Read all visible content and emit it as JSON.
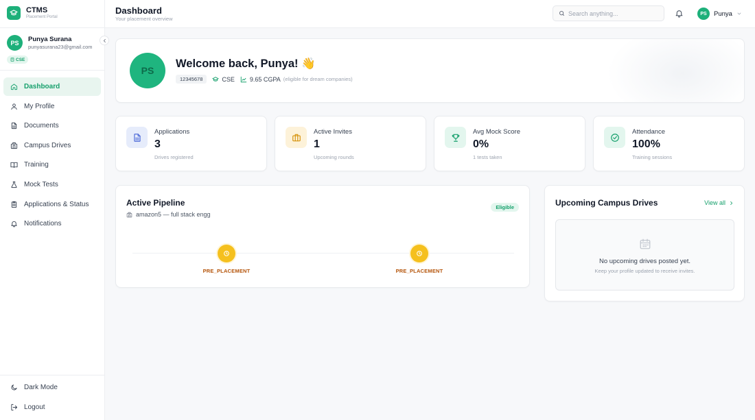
{
  "brand": {
    "name": "CTMS",
    "subtitle": "Placement Portal"
  },
  "user": {
    "initials": "PS",
    "name": "Punya Surana",
    "email": "punyasurana23@gmail.com",
    "department": "CSE",
    "first_name": "Punya"
  },
  "sidebar": {
    "items": [
      {
        "label": "Dashboard",
        "icon": "home-icon",
        "active": true
      },
      {
        "label": "My Profile",
        "icon": "user-icon"
      },
      {
        "label": "Documents",
        "icon": "document-icon"
      },
      {
        "label": "Campus Drives",
        "icon": "building-icon"
      },
      {
        "label": "Training",
        "icon": "book-icon"
      },
      {
        "label": "Mock Tests",
        "icon": "flask-icon"
      },
      {
        "label": "Applications & Status",
        "icon": "clipboard-icon"
      },
      {
        "label": "Notifications",
        "icon": "bell-icon"
      }
    ],
    "bottom": [
      {
        "label": "Dark Mode",
        "icon": "moon-icon"
      },
      {
        "label": "Logout",
        "icon": "logout-icon"
      }
    ]
  },
  "header": {
    "title": "Dashboard",
    "subtitle": "Your placement overview",
    "search_placeholder": "Search anything...",
    "user_name": "Punya"
  },
  "welcome": {
    "title": "Welcome back, Punya! 👋",
    "roll_number": "12345678",
    "branch": "CSE",
    "cgpa": "9.65 CGPA",
    "cgpa_note": "(eligible for dream companies)"
  },
  "stats": [
    {
      "label": "Applications",
      "value": "3",
      "sub": "Drives registered",
      "icon": "document-icon",
      "color": "#4f6bd8",
      "bg": "#e6ecfb"
    },
    {
      "label": "Active Invites",
      "value": "1",
      "sub": "Upcoming rounds",
      "icon": "briefcase-icon",
      "color": "#d6920b",
      "bg": "#fdf2d9"
    },
    {
      "label": "Avg Mock Score",
      "value": "0%",
      "sub": "1 tests taken",
      "icon": "trophy-icon",
      "color": "#16a06c",
      "bg": "#e3f6ee"
    },
    {
      "label": "Attendance",
      "value": "100%",
      "sub": "Training sessions",
      "icon": "check-circle-icon",
      "color": "#16a06c",
      "bg": "#e3f6ee"
    }
  ],
  "pipeline": {
    "title": "Active Pipeline",
    "subtitle": "amazon5 — full stack engg",
    "badge": "Eligible",
    "stages": [
      "PRE_PLACEMENT",
      "PRE_PLACEMENT"
    ]
  },
  "drives": {
    "title": "Upcoming Campus Drives",
    "view_all": "View all",
    "empty_title": "No upcoming drives posted yet.",
    "empty_sub": "Keep your profile updated to receive invites."
  },
  "colors": {
    "accent": "#16a06c",
    "brand": "#1db07a",
    "stage": "#f5c01e"
  }
}
